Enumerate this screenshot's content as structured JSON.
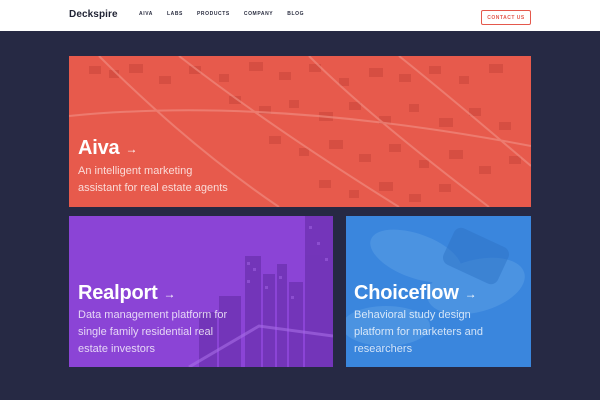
{
  "header": {
    "logo": "Deckspire",
    "nav": [
      "AIVA",
      "LABS",
      "PRODUCTS",
      "COMPANY",
      "BLOG"
    ],
    "contact_label": "CONTACT US"
  },
  "cards": {
    "aiva": {
      "title": "Aiva",
      "arrow": "→",
      "desc_line1": "An intelligent marketing",
      "desc_line2": "assistant for real estate agents"
    },
    "realport": {
      "title": "Realport",
      "arrow": "→",
      "desc_line1": "Data management platform for",
      "desc_line2": "single family residential real",
      "desc_line3": "estate investors"
    },
    "choiceflow": {
      "title": "Choiceflow",
      "arrow": "→",
      "desc_line1": "Behavioral study design",
      "desc_line2": "platform for marketers and",
      "desc_line3": "researchers"
    }
  },
  "colors": {
    "page_background": "#262944",
    "aiva_overlay": "#e75a4c",
    "realport_overlay": "#8b44d6",
    "choiceflow_overlay": "#3a86dd",
    "contact_accent": "#e4584c"
  }
}
